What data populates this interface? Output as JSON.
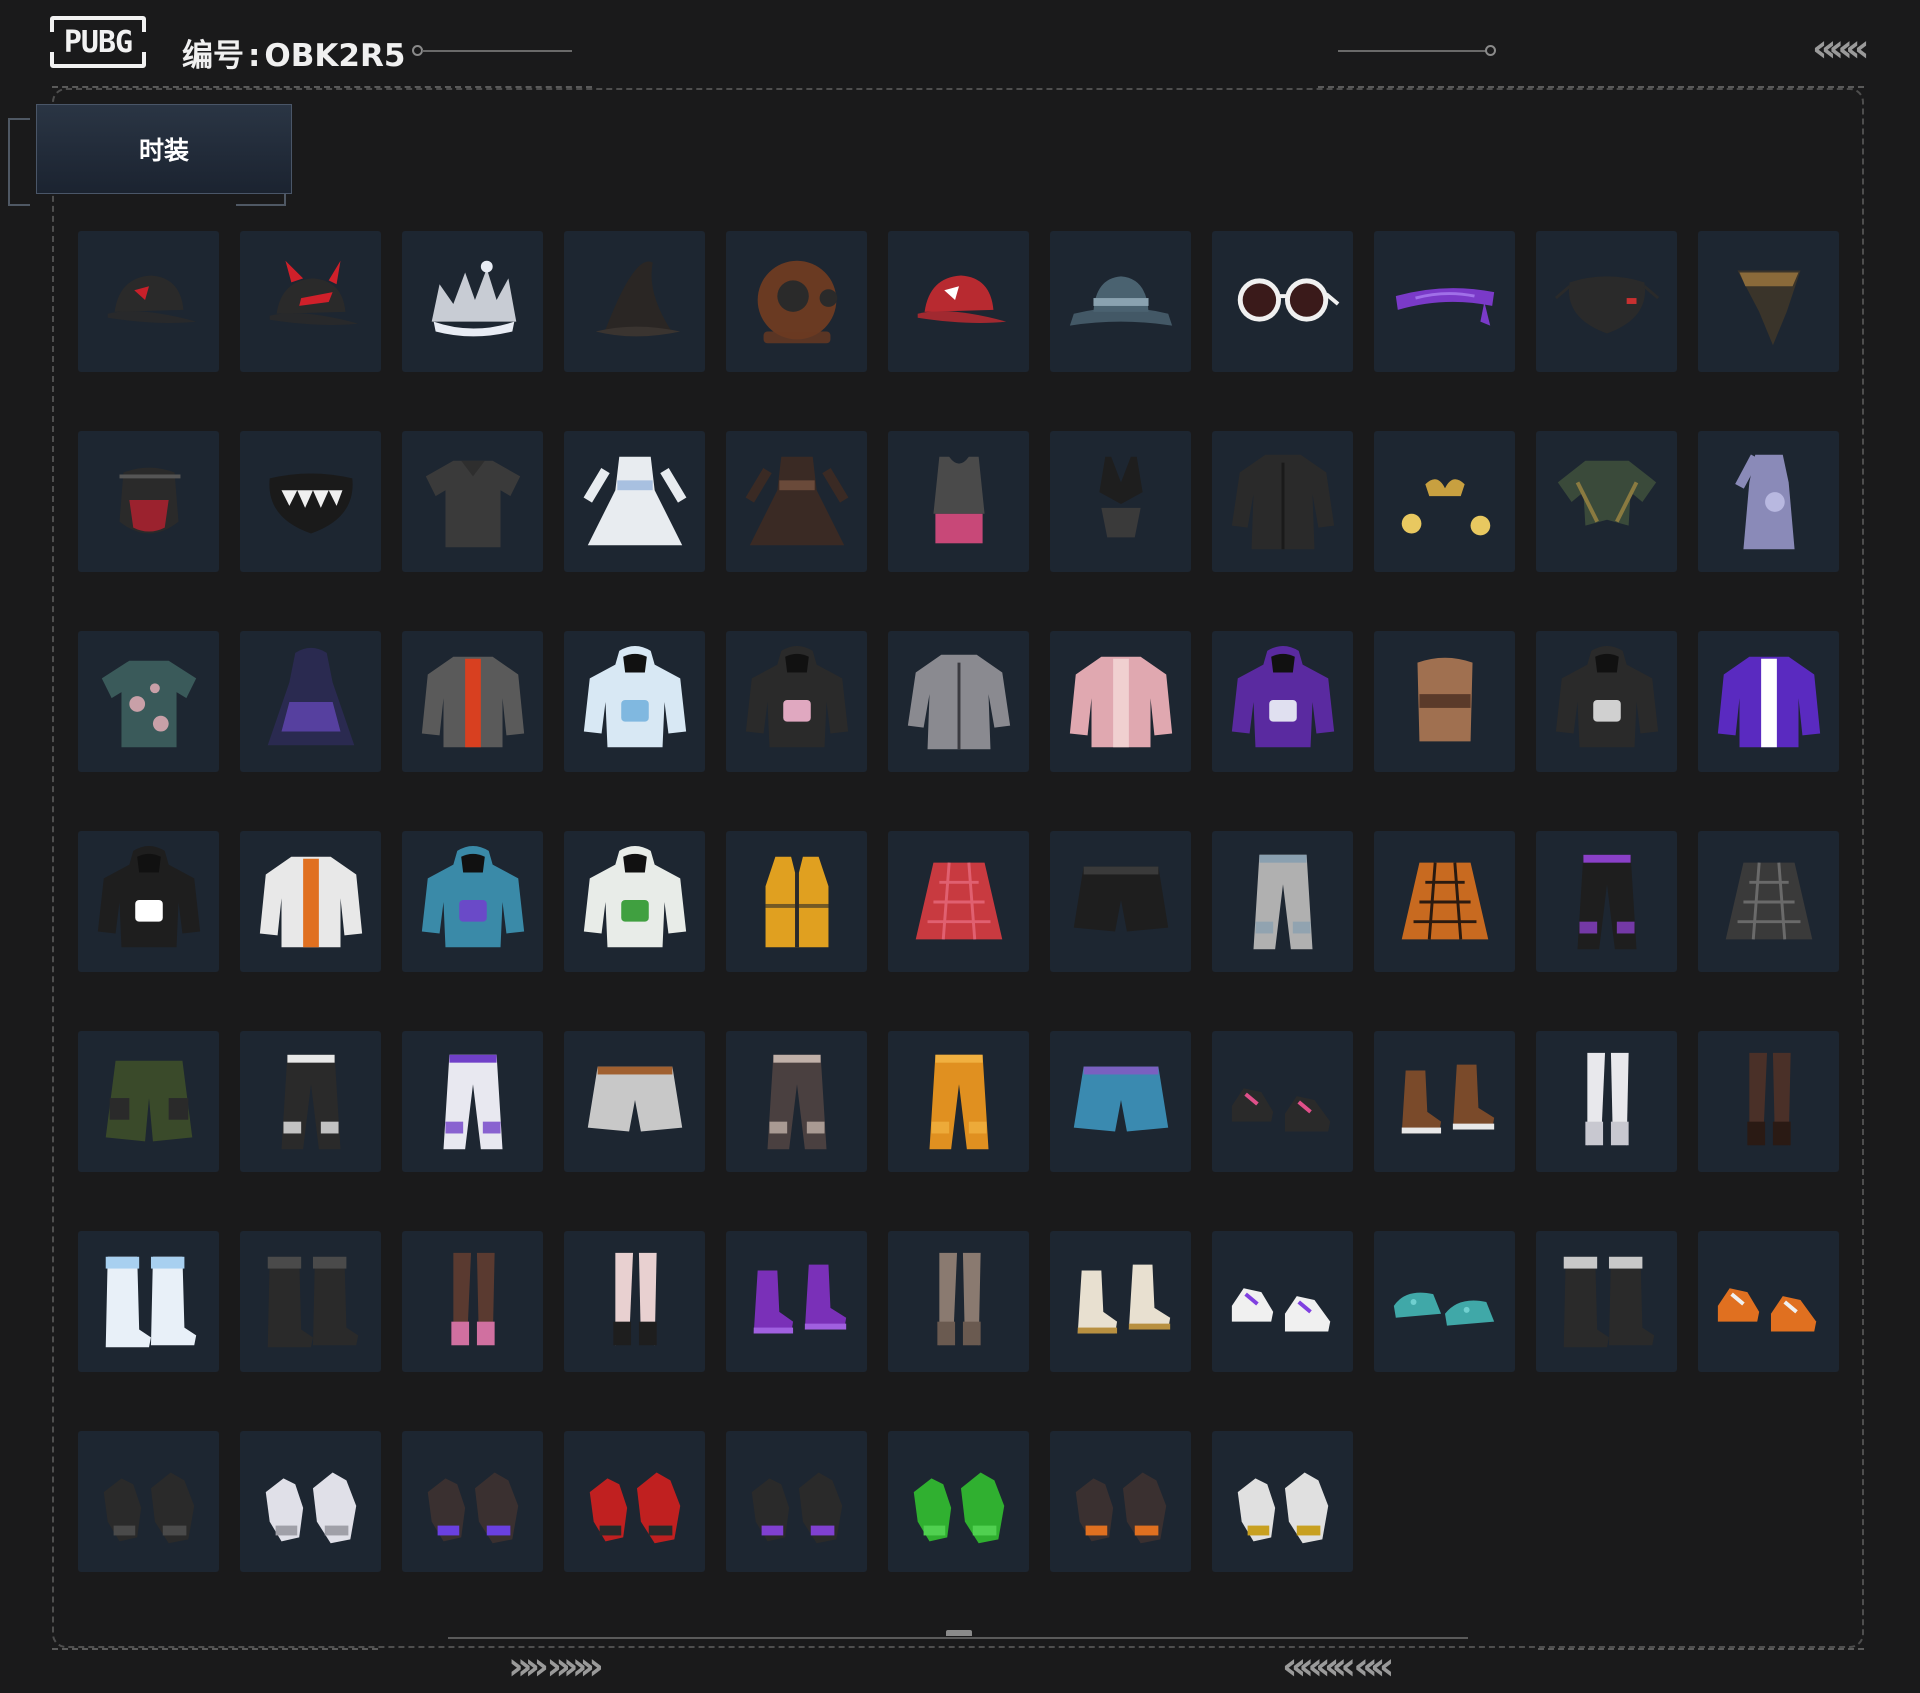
{
  "header": {
    "logo_text": "PUBG",
    "serial_label": "编号",
    "serial_sep": ":",
    "serial_value": "OBK2R5"
  },
  "tabs": [
    {
      "label": "时装",
      "active": true
    }
  ],
  "nav": {
    "top_right": "«««",
    "bottom_left": "»» »»»",
    "bottom_right": "«««« ««"
  },
  "colors": {
    "background": "#1a1a1b",
    "tile": "#1d2631",
    "tab": "#2a3544"
  },
  "items": [
    {
      "icon": "baseball-cap-icon",
      "color": "#2a2a2a",
      "accent": "#c8202a"
    },
    {
      "icon": "horned-cap-icon",
      "color": "#2a2a2a",
      "accent": "#d0202a"
    },
    {
      "icon": "crown-icon",
      "color": "#c8ccd4",
      "accent": "#e8ecf4"
    },
    {
      "icon": "witch-hat-icon",
      "color": "#2a2624",
      "accent": "#3a3430"
    },
    {
      "icon": "diving-helmet-icon",
      "color": "#6a3a22",
      "accent": "#2a2a2a"
    },
    {
      "icon": "baseball-cap-icon",
      "color": "#b82a30",
      "accent": "#ffffff"
    },
    {
      "icon": "bucket-hat-icon",
      "color": "#4a6270",
      "accent": "#8aa2b0"
    },
    {
      "icon": "sunglasses-icon",
      "color": "#f0f0f0",
      "accent": "#3a1a1a"
    },
    {
      "icon": "headband-icon",
      "color": "#7a3ac8",
      "accent": "#a070e8"
    },
    {
      "icon": "face-mask-icon",
      "color": "#2a2a2a",
      "accent": "#c83030"
    },
    {
      "icon": "bandana-icon",
      "color": "#3a342a",
      "accent": "#8a6a3a"
    },
    {
      "icon": "tactical-mask-icon",
      "color": "#2a2a2a",
      "accent": "#b82030"
    },
    {
      "icon": "teeth-mask-icon",
      "color": "#1a1a1a",
      "accent": "#f0f0f0"
    },
    {
      "icon": "polo-shirt-icon",
      "color": "#3a3a3a",
      "accent": "#2e2e2e"
    },
    {
      "icon": "dress-icon",
      "color": "#e8ecf0",
      "accent": "#a8c0e0"
    },
    {
      "icon": "dress-icon",
      "color": "#3a2a24",
      "accent": "#6a4a3a"
    },
    {
      "icon": "tank-top-icon",
      "color": "#4a4a4a",
      "accent": "#c84878"
    },
    {
      "icon": "swimsuit-icon",
      "color": "#1e1e1e",
      "accent": "#3a3a3a"
    },
    {
      "icon": "coat-icon",
      "color": "#2a2a2a",
      "accent": "#1a1a1a"
    },
    {
      "icon": "bikini-icon",
      "color": "#c8a040",
      "accent": "#e8c860"
    },
    {
      "icon": "tied-shirt-icon",
      "color": "#3a4a3a",
      "accent": "#8a7a40"
    },
    {
      "icon": "qipao-icon",
      "color": "#8a8ab8",
      "accent": "#b8b8e0"
    },
    {
      "icon": "shirt-icon",
      "color": "#3a5a5a",
      "accent": "#c8a0a8"
    },
    {
      "icon": "hooded-dress-icon",
      "color": "#2a2a50",
      "accent": "#6a4ac0"
    },
    {
      "icon": "jacket-icon",
      "color": "#5a5a5a",
      "accent": "#d84020"
    },
    {
      "icon": "hoodie-icon",
      "color": "#d8e8f4",
      "accent": "#80b8e0"
    },
    {
      "icon": "hoodie-icon",
      "color": "#2a2a2a",
      "accent": "#e0a8c0"
    },
    {
      "icon": "coat-icon",
      "color": "#8a8a90",
      "accent": "#3a3a40"
    },
    {
      "icon": "jacket-icon",
      "color": "#e0a8b0",
      "accent": "#f0d0d0"
    },
    {
      "icon": "hoodie-icon",
      "color": "#5a2aa0",
      "accent": "#e0e0f0"
    },
    {
      "icon": "corset-icon",
      "color": "#a07050",
      "accent": "#5a3a2a"
    },
    {
      "icon": "hoodie-icon",
      "color": "#2a2a2a",
      "accent": "#d0d0d0"
    },
    {
      "icon": "jacket-icon",
      "color": "#5a2ac0",
      "accent": "#ffffff"
    },
    {
      "icon": "hoodie-icon",
      "color": "#1e1e1e",
      "accent": "#ffffff"
    },
    {
      "icon": "jacket-icon",
      "color": "#e8e8e8",
      "accent": "#e07020"
    },
    {
      "icon": "hoodie-icon",
      "color": "#3a8aa8",
      "accent": "#6a4ac8"
    },
    {
      "icon": "hoodie-icon",
      "color": "#e8ece8",
      "accent": "#40a040"
    },
    {
      "icon": "vest-icon",
      "color": "#e0a020",
      "accent": "#2a2a2a"
    },
    {
      "icon": "skirt-icon",
      "color": "#c83a40",
      "accent": "#e06070"
    },
    {
      "icon": "shorts-icon",
      "color": "#1e1e1e",
      "accent": "#3a3a3a"
    },
    {
      "icon": "pants-icon",
      "color": "#b0b0b0",
      "accent": "#8aa0b0"
    },
    {
      "icon": "skirt-icon",
      "color": "#c86a20",
      "accent": "#2a1a10"
    },
    {
      "icon": "pants-icon",
      "color": "#1e1e1e",
      "accent": "#8a40c8"
    },
    {
      "icon": "skirt-icon",
      "color": "#3a3a3a",
      "accent": "#6a6a6a"
    },
    {
      "icon": "cargo-shorts-icon",
      "color": "#3a4a2a",
      "accent": "#2a2a2a"
    },
    {
      "icon": "pants-icon",
      "color": "#2a2a2a",
      "accent": "#e8e8e8"
    },
    {
      "icon": "pants-icon",
      "color": "#e8e8f0",
      "accent": "#7040c8"
    },
    {
      "icon": "shorts-icon",
      "color": "#c8c8c8",
      "accent": "#a06030"
    },
    {
      "icon": "pants-icon",
      "color": "#4a4040",
      "accent": "#c0b0a8"
    },
    {
      "icon": "pants-icon",
      "color": "#e09020",
      "accent": "#f0b040"
    },
    {
      "icon": "shorts-icon",
      "color": "#3a8ab0",
      "accent": "#7a60c0"
    },
    {
      "icon": "sneakers-icon",
      "color": "#2a2a2a",
      "accent": "#e0508a"
    },
    {
      "icon": "boots-icon",
      "color": "#7a4a2a",
      "accent": "#e8e8e8"
    },
    {
      "icon": "stockings-icon",
      "color": "#e8e8ec",
      "accent": "#c8c8d0"
    },
    {
      "icon": "stockings-icon",
      "color": "#4a3028",
      "accent": "#2a1a14"
    },
    {
      "icon": "furry-boots-icon",
      "color": "#e8f0f8",
      "accent": "#a8d0f0"
    },
    {
      "icon": "furry-boots-icon",
      "color": "#2a2a2a",
      "accent": "#4a4a4a"
    },
    {
      "icon": "stockings-icon",
      "color": "#5a3a30",
      "accent": "#d070a0"
    },
    {
      "icon": "stockings-icon",
      "color": "#e8d0d0",
      "accent": "#1e1e1e"
    },
    {
      "icon": "boots-icon",
      "color": "#7a30b8",
      "accent": "#a060e0"
    },
    {
      "icon": "stockings-icon",
      "color": "#8a7a70",
      "accent": "#6a5a50"
    },
    {
      "icon": "boots-icon",
      "color": "#e8e0d0",
      "accent": "#b89040"
    },
    {
      "icon": "sneakers-icon",
      "color": "#f0f0f0",
      "accent": "#8040e0"
    },
    {
      "icon": "clogs-icon",
      "color": "#40a8a8",
      "accent": "#70d0d0"
    },
    {
      "icon": "furry-boots-icon",
      "color": "#2a2a2a",
      "accent": "#c8c8c8"
    },
    {
      "icon": "sneakers-icon",
      "color": "#e07020",
      "accent": "#f0f0f0"
    },
    {
      "icon": "gloves-icon",
      "color": "#2a2a2a",
      "accent": "#4a4a4a"
    },
    {
      "icon": "gloves-icon",
      "color": "#e0e0e8",
      "accent": "#a0a0a8"
    },
    {
      "icon": "gloves-icon",
      "color": "#3a3030",
      "accent": "#6a40e0"
    },
    {
      "icon": "gloves-icon",
      "color": "#c02020",
      "accent": "#2a2a2a"
    },
    {
      "icon": "gloves-icon",
      "color": "#2a2a2a",
      "accent": "#8040d0"
    },
    {
      "icon": "gloves-icon",
      "color": "#30b030",
      "accent": "#50d050"
    },
    {
      "icon": "gloves-icon",
      "color": "#3a3030",
      "accent": "#e07020"
    },
    {
      "icon": "gloves-icon",
      "color": "#e0e0e0",
      "accent": "#c8a020"
    }
  ]
}
